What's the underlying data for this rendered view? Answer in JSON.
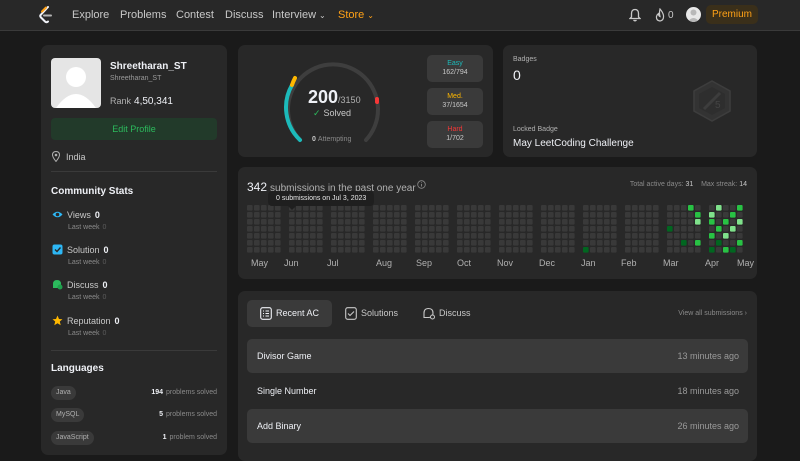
{
  "nav": {
    "items": [
      {
        "label": "Explore"
      },
      {
        "label": "Problems"
      },
      {
        "label": "Contest"
      },
      {
        "label": "Discuss"
      },
      {
        "label": "Interview"
      },
      {
        "label": "Store"
      }
    ],
    "streak": "0",
    "premium_label": "Premium",
    "accent": "#ffa116"
  },
  "profile": {
    "name": "Shreetharan_ST",
    "handle": "Shreetharan_ST",
    "rank_label": "Rank",
    "rank_value": "4,50,341",
    "edit_label": "Edit Profile",
    "location": "India"
  },
  "community": {
    "title": "Community Stats",
    "stats": [
      {
        "label": "Views",
        "value": "0",
        "sub": "Last week",
        "sub_value": "0",
        "icon": "eye-icon",
        "color": "#2db7f5"
      },
      {
        "label": "Solution",
        "value": "0",
        "sub": "Last week",
        "sub_value": "0",
        "icon": "solution-icon",
        "color": "#2db7f5"
      },
      {
        "label": "Discuss",
        "value": "0",
        "sub": "Last week",
        "sub_value": "0",
        "icon": "discuss-icon",
        "color": "#2cbb5d"
      },
      {
        "label": "Reputation",
        "value": "0",
        "sub": "Last week",
        "sub_value": "0",
        "icon": "star-icon",
        "color": "#ffb800"
      }
    ]
  },
  "languages": {
    "title": "Languages",
    "items": [
      {
        "name": "Java",
        "count": "194",
        "suffix": "problems solved"
      },
      {
        "name": "MySQL",
        "count": "5",
        "suffix": "problems solved"
      },
      {
        "name": "JavaScript",
        "count": "1",
        "suffix": "problem solved"
      }
    ]
  },
  "solved": {
    "count": "200",
    "total": "/3150",
    "label": "Solved",
    "attempting_count": "0",
    "attempting_label": "Attempting",
    "difficulties": [
      {
        "name": "Easy",
        "count": "162/794",
        "color": "#1cbaba"
      },
      {
        "name": "Med.",
        "count": "37/1654",
        "color": "#ffb800"
      },
      {
        "name": "Hard",
        "count": "1/702",
        "color": "#f63737"
      }
    ]
  },
  "badges": {
    "title": "Badges",
    "count": "0",
    "locked_label": "Locked Badge",
    "locked_name": "May LeetCoding Challenge",
    "badge_number": "5"
  },
  "heatmap": {
    "count": "342",
    "title": "submissions in the past one year",
    "active_days_label": "Total active days:",
    "active_days": "31",
    "max_streak_label": "Max streak:",
    "max_streak": "14",
    "tooltip": "0 submissions on Jul 3, 2023",
    "months": [
      "May",
      "Jun",
      "Jul",
      "Aug",
      "Sep",
      "Oct",
      "Nov",
      "Dec",
      "Jan",
      "Feb",
      "Mar",
      "Apr",
      "May"
    ],
    "colors": {
      "empty": "#393939",
      "low": "#016620",
      "mid": "#28c244",
      "high": "#7fe18b"
    }
  },
  "submissions": {
    "tabs": [
      {
        "label": "Recent AC",
        "icon": "list-icon"
      },
      {
        "label": "Solutions",
        "icon": "check-square-icon"
      },
      {
        "label": "Discuss",
        "icon": "discuss-icon"
      }
    ],
    "view_all": "View all submissions",
    "rows": [
      {
        "title": "Divisor Game",
        "time": "13 minutes ago"
      },
      {
        "title": "Single Number",
        "time": "18 minutes ago"
      },
      {
        "title": "Add Binary",
        "time": "26 minutes ago"
      }
    ]
  }
}
